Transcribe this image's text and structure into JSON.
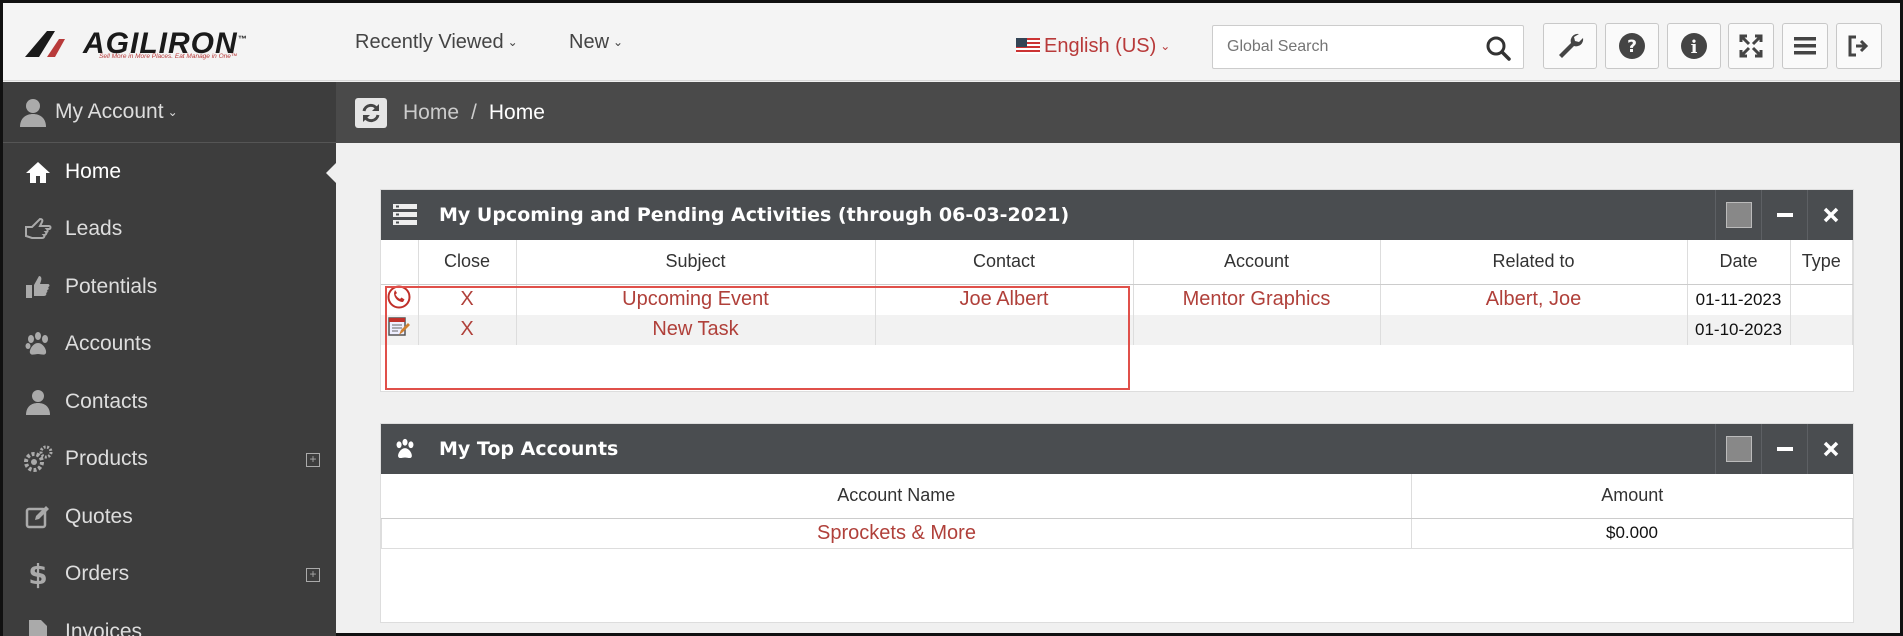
{
  "header": {
    "logo_text": "AGILIRON",
    "logo_tm": "™",
    "logo_tagline": "Sell More in More Places. Eat Manage in One™",
    "nav": [
      {
        "label": "Recently Viewed"
      },
      {
        "label": "New"
      }
    ],
    "language": "English (US)",
    "search_placeholder": "Global Search",
    "tools": [
      "wrench-icon",
      "question-icon",
      "info-icon",
      "expand-icon",
      "menu-icon",
      "logout-icon"
    ]
  },
  "sidebar": {
    "account_label": "My Account",
    "items": [
      {
        "label": "Home",
        "icon": "home-icon",
        "active": true
      },
      {
        "label": "Leads",
        "icon": "hand-point-icon"
      },
      {
        "label": "Potentials",
        "icon": "thumbs-up-icon"
      },
      {
        "label": "Accounts",
        "icon": "paw-icon"
      },
      {
        "label": "Contacts",
        "icon": "user-icon"
      },
      {
        "label": "Products",
        "icon": "gears-icon",
        "expandable": true
      },
      {
        "label": "Quotes",
        "icon": "edit-icon"
      },
      {
        "label": "Orders",
        "icon": "dollar-icon",
        "expandable": true
      },
      {
        "label": "Invoices",
        "icon": "document-icon"
      }
    ]
  },
  "breadcrumb": {
    "items": [
      "Home",
      "Home"
    ],
    "separator": "/"
  },
  "activities_panel": {
    "title": "My Upcoming and Pending Activities (through 06-03-2021)",
    "columns": [
      "",
      "Close",
      "Subject",
      "Contact",
      "Account",
      "Related to",
      "Date",
      "Type"
    ],
    "rows": [
      {
        "icon": "phone-call-icon",
        "close": "X",
        "subject": "Upcoming Event",
        "contact": "Joe Albert",
        "account": "Mentor Graphics",
        "related": "Albert, Joe",
        "date": "01-11-2023",
        "type": ""
      },
      {
        "icon": "task-edit-icon",
        "close": "X",
        "subject": "New Task",
        "contact": "",
        "account": "",
        "related": "",
        "date": "01-10-2023",
        "type": ""
      }
    ]
  },
  "accounts_panel": {
    "title": "My Top Accounts",
    "columns": [
      "Account Name",
      "Amount"
    ],
    "rows": [
      {
        "name": "Sprockets & More",
        "amount": "$0.000"
      }
    ]
  },
  "colors": {
    "accent": "#b0403a",
    "sidebar_bg": "#3d3d3d",
    "panel_header": "#4a4d50",
    "highlight": "#e0504a"
  }
}
